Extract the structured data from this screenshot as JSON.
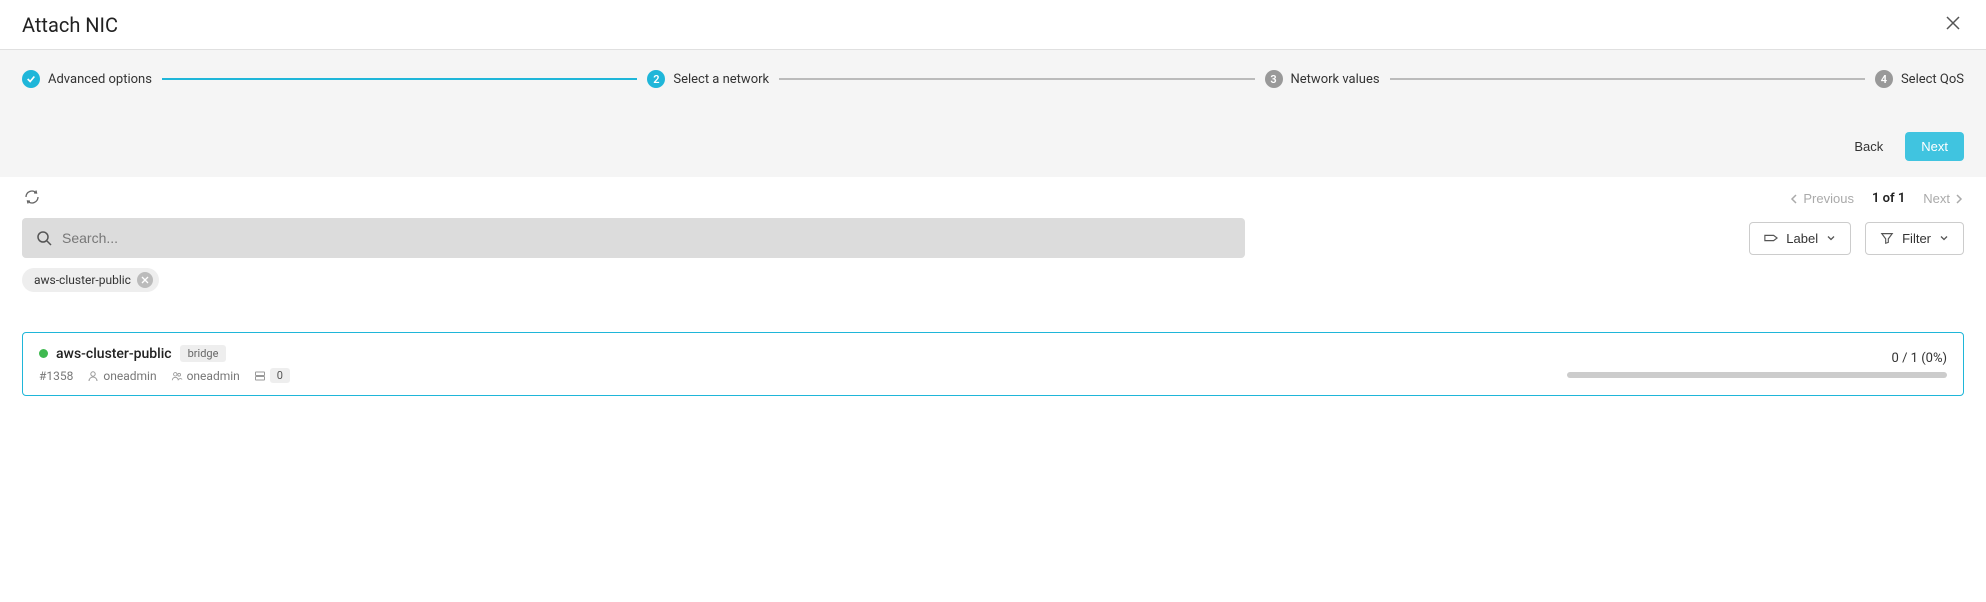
{
  "header": {
    "title": "Attach NIC"
  },
  "stepper": {
    "steps": [
      {
        "label": "Advanced options"
      },
      {
        "label": "Select a network"
      },
      {
        "label": "Network values"
      },
      {
        "label": "Select QoS"
      }
    ],
    "num2": "2",
    "num3": "3",
    "num4": "4"
  },
  "wizard": {
    "back": "Back",
    "next": "Next"
  },
  "pager": {
    "prev": "Previous",
    "info": "1 of 1",
    "next": "Next"
  },
  "search": {
    "placeholder": "Search..."
  },
  "buttons": {
    "label": "Label",
    "filter": "Filter"
  },
  "chip": {
    "text": "aws-cluster-public"
  },
  "network": {
    "name": "aws-cluster-public",
    "type": "bridge",
    "id": "#1358",
    "owner": "oneadmin",
    "group": "oneadmin",
    "count": "0",
    "usage": "0 / 1 (0%)"
  }
}
